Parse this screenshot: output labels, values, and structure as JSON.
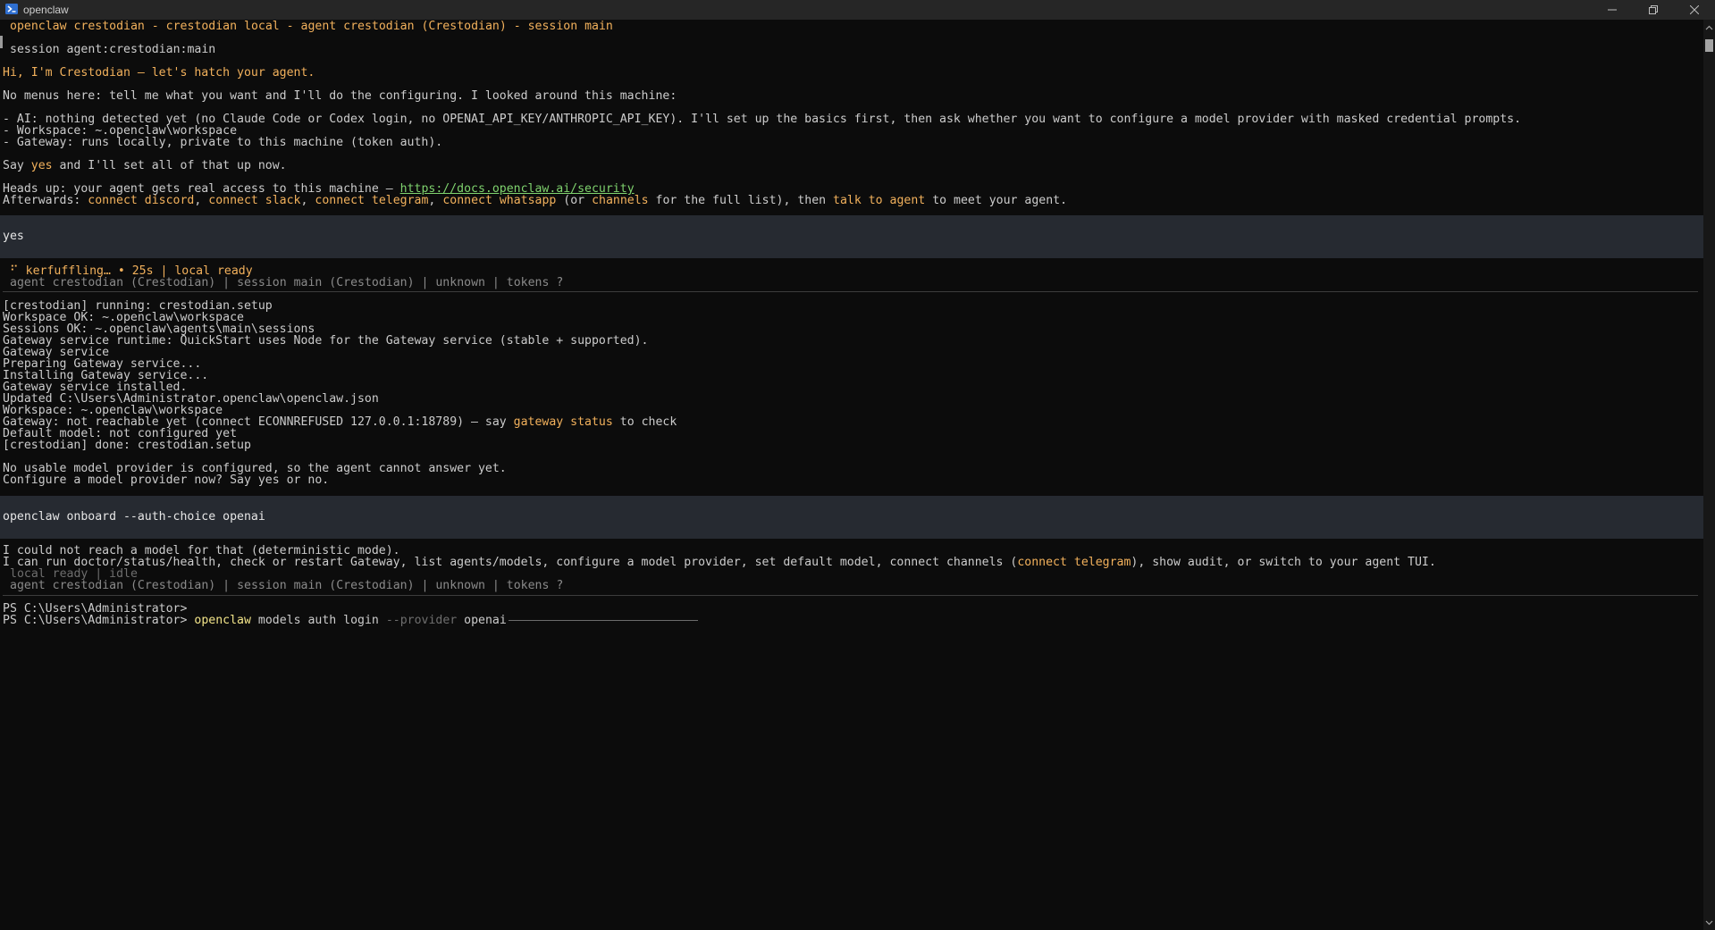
{
  "window": {
    "title": "openclaw",
    "controls": {
      "minimize": "minimize-icon",
      "restore": "restore-icon",
      "close": "close-icon"
    }
  },
  "header": {
    "session_title": "openclaw crestodian - crestodian local - agent crestodian (Crestodian) - session main",
    "session_id": "session agent:crestodian:main"
  },
  "intro": {
    "greeting": "Hi, I'm Crestodian — let's hatch your agent.",
    "menus": "No menus here: tell me what you want and I'll do the configuring. I looked around this machine:",
    "ai": "- AI: nothing detected yet (no Claude Code or Codex login, no OPENAI_API_KEY/ANTHROPIC_API_KEY). I'll set up the basics first, then ask whether you want to configure a model provider with masked credential prompts.",
    "workspace": "- Workspace: ~.openclaw\\workspace",
    "gateway": "- Gateway: runs locally, private to this machine (token auth).",
    "say_prefix": "Say ",
    "say_yes": "yes",
    "say_suffix": " and I'll set all of that up now.",
    "heads_up_prefix": "Heads up: your agent gets real access to this machine — ",
    "heads_up_link": "https://docs.openclaw.ai/security",
    "afterwards_prefix": "Afterwards: ",
    "connect_discord": "connect discord",
    "connect_slack": "connect slack",
    "connect_telegram": "connect telegram",
    "connect_whatsapp": "connect whatsapp",
    "sep": ", ",
    "or_open": " (or ",
    "channels": "channels",
    "full_list": " for the full list), then ",
    "talk_to_agent": "talk to agent",
    "to_meet": " to meet your agent."
  },
  "user_input_1": "yes",
  "status_1": {
    "spinner": "⠋",
    "activity": "kerfuffling… • 25s | local ready",
    "info": "agent crestodian (Crestodian) | session main (Crestodian) | unknown | tokens ?"
  },
  "setup_log": [
    "[crestodian] running: crestodian.setup",
    "Workspace OK: ~.openclaw\\workspace",
    "Sessions OK: ~.openclaw\\agents\\main\\sessions",
    "Gateway service runtime: QuickStart uses Node for the Gateway service (stable + supported).",
    "Gateway service",
    "Preparing Gateway service...",
    "Installing Gateway service...",
    "Gateway service installed.",
    "Updated C:\\Users\\Administrator.openclaw\\openclaw.json",
    "Workspace: ~.openclaw\\workspace"
  ],
  "gateway_status": {
    "prefix": "Gateway: not reachable yet (connect ECONNREFUSED 127.0.0.1:18789) — say ",
    "command": "gateway status",
    "suffix": " to check"
  },
  "setup_log_end": [
    "Default model: not configured yet",
    "[crestodian] done: crestodian.setup"
  ],
  "provider_prompt": [
    "No usable model provider is configured, so the agent cannot answer yet.",
    "Configure a model provider now? Say yes or no."
  ],
  "user_input_2": "openclaw onboard --auth-choice openai",
  "reply": {
    "line1": "I could not reach a model for that (deterministic mode).",
    "line2_prefix": "I can run doctor/status/health, check or restart Gateway, list agents/models, configure a model provider, set default model, connect channels (",
    "line2_link": "connect telegram",
    "line2_suffix": "), show audit, or switch to your agent TUI."
  },
  "status_2": {
    "state": "local ready | idle",
    "info": "agent crestodian (Crestodian) | session main (Crestodian) | unknown | tokens ?"
  },
  "shell": {
    "prompt1": "PS C:\\Users\\Administrator>",
    "prompt2": "PS C:\\Users\\Administrator>",
    "cmd_name": "openclaw",
    "cmd_args": "models auth login",
    "cmd_flag": "--provider",
    "cmd_value": "openai"
  },
  "colors": {
    "background": "#0c0c0c",
    "text": "#cccccc",
    "accent_orange": "#f2b15c",
    "link_green": "#7fd36e",
    "input_band": "#262a31"
  }
}
